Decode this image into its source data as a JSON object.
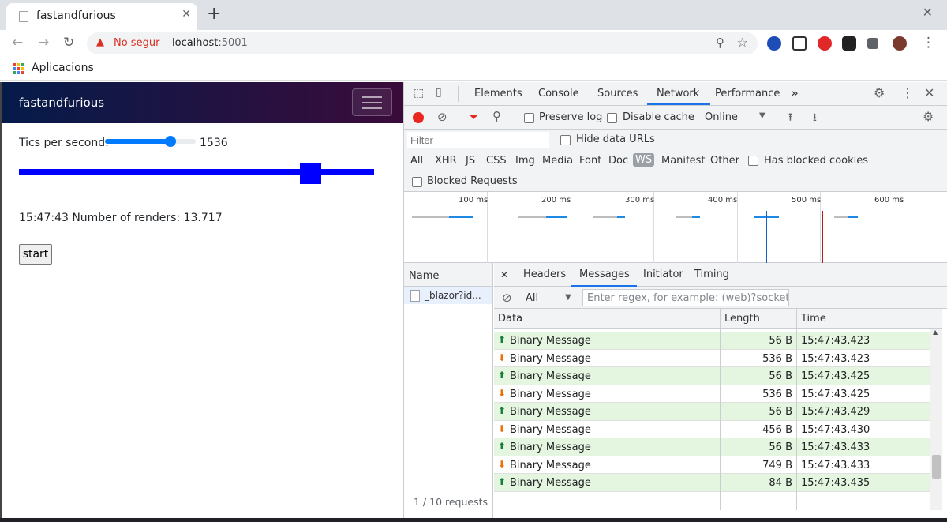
{
  "browser": {
    "tab_title": "fastandfurious",
    "new_tab": "+",
    "close_tab": "✕",
    "window_close": "✕",
    "security_label": "No segur",
    "url_host": "localhost",
    "url_port": ":5001",
    "bookmarks_label": "Aplicacions"
  },
  "app": {
    "brand": "fastandfurious",
    "tics_label": "Tics per second:",
    "tics_value": "1536",
    "tics_fraction": 0.72,
    "runner_fraction": 0.79,
    "renders_text": "15:47:43 Number of renders: 13.717",
    "start_label": "start"
  },
  "devtools": {
    "tabs": [
      "Elements",
      "Console",
      "Sources",
      "Network",
      "Performance"
    ],
    "active_tab": "Network",
    "more": "»",
    "preserve_log": "Preserve log",
    "disable_cache": "Disable cache",
    "throttle": "Online",
    "filter_placeholder": "Filter",
    "hide_data_urls": "Hide data URLs",
    "types": [
      "All",
      "XHR",
      "JS",
      "CSS",
      "Img",
      "Media",
      "Font",
      "Doc",
      "WS",
      "Manifest",
      "Other"
    ],
    "active_type": "WS",
    "has_blocked_cookies": "Has blocked cookies",
    "blocked_requests": "Blocked Requests",
    "timeline_labels": [
      "100 ms",
      "200 ms",
      "300 ms",
      "400 ms",
      "500 ms",
      "600 ms"
    ],
    "name_header": "Name",
    "request_name": "_blazor?id...",
    "requests_count": "1 / 10 requests",
    "detail_close": "✕",
    "detail_tabs": [
      "Headers",
      "Messages",
      "Initiator",
      "Timing"
    ],
    "active_detail_tab": "Messages",
    "msg_filter_select": "All",
    "regex_placeholder": "Enter regex, for example: (web)?socket",
    "columns": [
      "Data",
      "Length",
      "Time"
    ],
    "messages": [
      {
        "dir": "up",
        "arrow": "⬆",
        "data": "Binary Message",
        "length": "56 B",
        "time": "15:47:43.423"
      },
      {
        "dir": "down",
        "arrow": "⬇",
        "data": "Binary Message",
        "length": "536 B",
        "time": "15:47:43.423"
      },
      {
        "dir": "up",
        "arrow": "⬆",
        "data": "Binary Message",
        "length": "56 B",
        "time": "15:47:43.425"
      },
      {
        "dir": "down",
        "arrow": "⬇",
        "data": "Binary Message",
        "length": "536 B",
        "time": "15:47:43.425"
      },
      {
        "dir": "up",
        "arrow": "⬆",
        "data": "Binary Message",
        "length": "56 B",
        "time": "15:47:43.429"
      },
      {
        "dir": "down",
        "arrow": "⬇",
        "data": "Binary Message",
        "length": "456 B",
        "time": "15:47:43.430"
      },
      {
        "dir": "up",
        "arrow": "⬆",
        "data": "Binary Message",
        "length": "56 B",
        "time": "15:47:43.433"
      },
      {
        "dir": "down",
        "arrow": "⬇",
        "data": "Binary Message",
        "length": "749 B",
        "time": "15:47:43.433"
      },
      {
        "dir": "up",
        "arrow": "⬆",
        "data": "Binary Message",
        "length": "84 B",
        "time": "15:47:43.435"
      }
    ],
    "colors": {
      "record": "#e8271f",
      "accent": "#1a73e8",
      "sent_row": "#e4f5e0",
      "up_arrow": "#188038",
      "down_arrow": "#e8710a"
    }
  }
}
